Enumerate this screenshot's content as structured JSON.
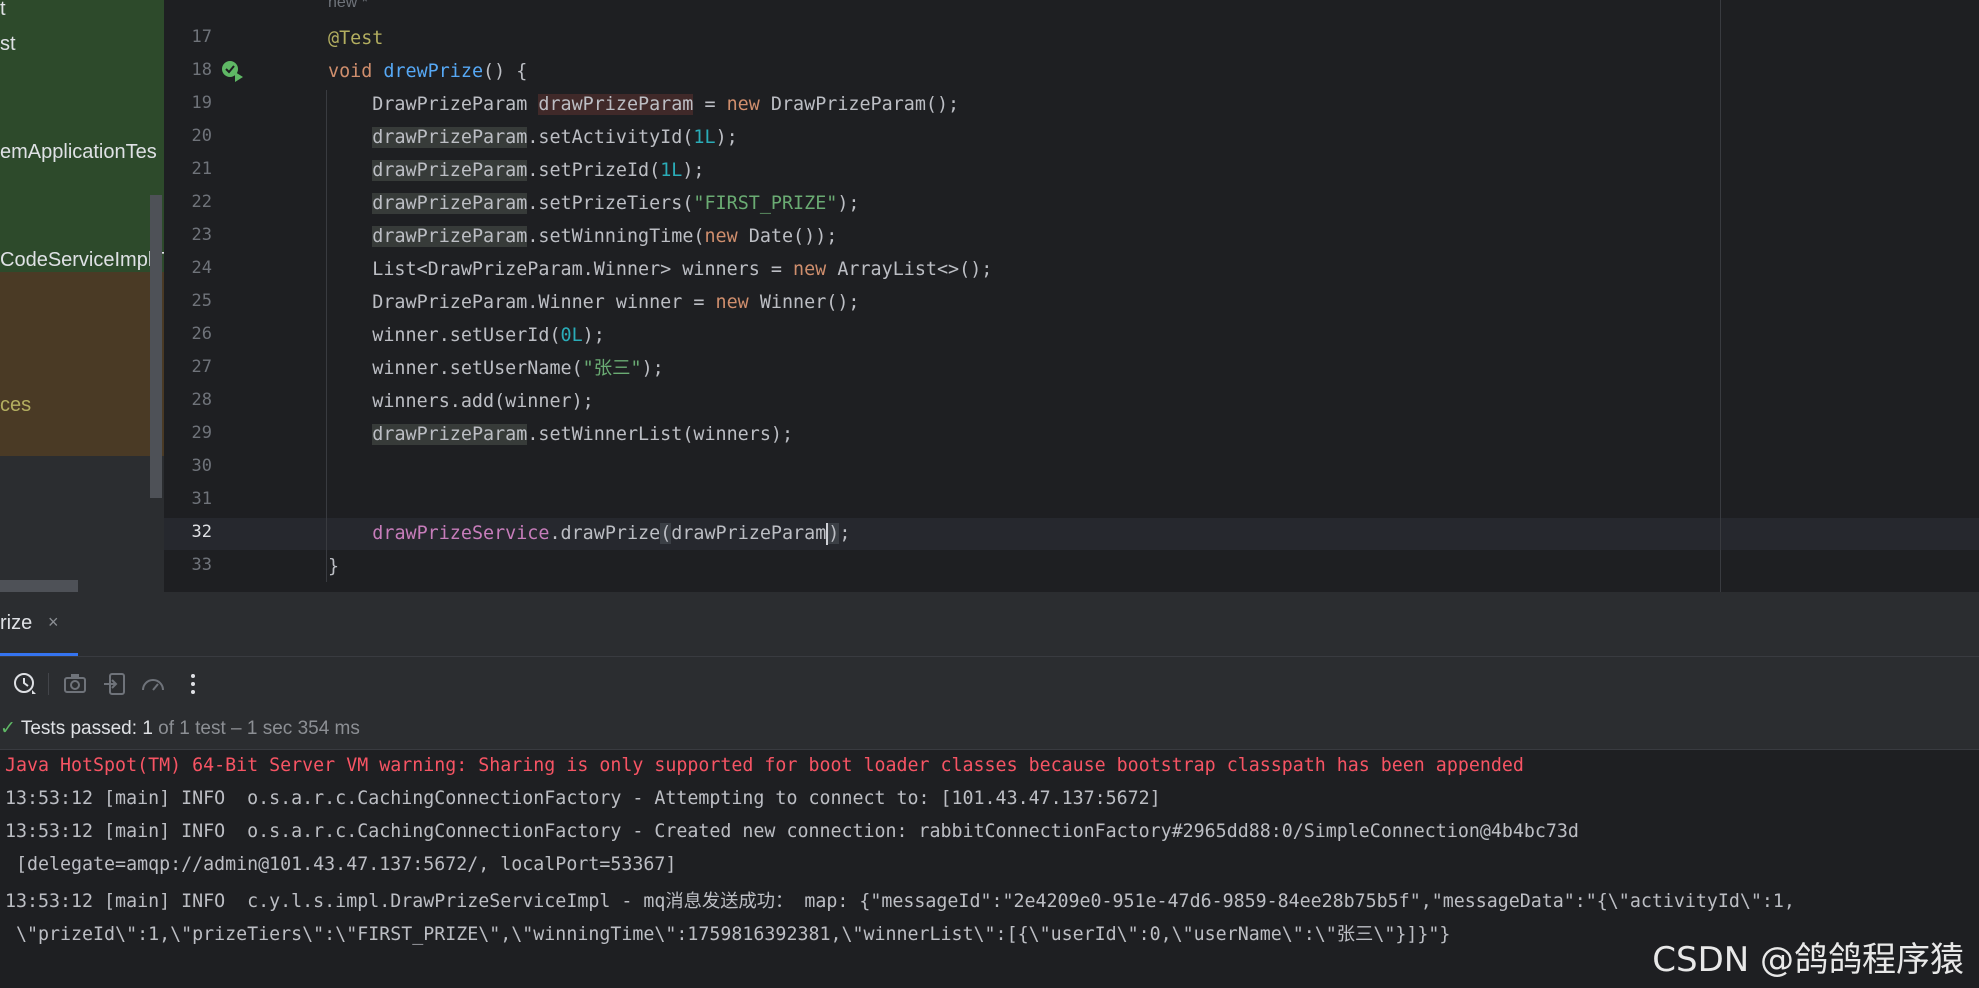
{
  "sidebar": {
    "items": [
      {
        "label": "t"
      },
      {
        "label": "st"
      },
      {
        "label": "emApplicationTes"
      },
      {
        "label": "CodeServiceImplT"
      },
      {
        "label": "ces"
      }
    ]
  },
  "editor": {
    "inlay_hint": "new *",
    "current_line": 32,
    "lines": [
      {
        "no": "17"
      },
      {
        "no": "18"
      },
      {
        "no": "19"
      },
      {
        "no": "20"
      },
      {
        "no": "21"
      },
      {
        "no": "22"
      },
      {
        "no": "23"
      },
      {
        "no": "24"
      },
      {
        "no": "25"
      },
      {
        "no": "26"
      },
      {
        "no": "27"
      },
      {
        "no": "28"
      },
      {
        "no": "29"
      },
      {
        "no": "30"
      },
      {
        "no": "31"
      },
      {
        "no": "32"
      },
      {
        "no": "33"
      }
    ]
  },
  "run_panel": {
    "tab_label": "rize",
    "tab_close": "×",
    "status_check": "✓",
    "status_label": "Tests passed:",
    "status_count": "1",
    "status_detail": "of 1 test – 1 sec 354 ms",
    "console": [
      {
        "text": "Java HotSpot(TM) 64-Bit Server VM warning: Sharing is only supported for boot loader classes because bootstrap classpath has been appended",
        "type": "err"
      },
      {
        "text": "13:53:12 [main] INFO  o.s.a.r.c.CachingConnectionFactory - Attempting to connect to: [101.43.47.137:5672]",
        "type": "info"
      },
      {
        "text": "13:53:12 [main] INFO  o.s.a.r.c.CachingConnectionFactory - Created new connection: rabbitConnectionFactory#2965dd88:0/SimpleConnection@4b4bc73d",
        "type": "info"
      },
      {
        "text": " [delegate=amqp://admin@101.43.47.137:5672/, localPort=53367]",
        "type": "info"
      },
      {
        "text": "13:53:12 [main] INFO  c.y.l.s.impl.DrawPrizeServiceImpl - mq消息发送成功： map: {\"messageId\":\"2e4209e0-951e-47d6-9859-84ee28b75b5f\",\"messageData\":\"{\\\"activityId\\\":1,",
        "type": "info"
      },
      {
        "text": " \\\"prizeId\\\":1,\\\"prizeTiers\\\":\\\"FIRST_PRIZE\\\",\\\"winningTime\\\":1759816392381,\\\"winnerList\\\":[{\\\"userId\\\":0,\\\"userName\\\":\\\"张三\\\"}]}\"}",
        "type": "info"
      }
    ]
  },
  "watermark": "CSDN @鸽鸽程序猿",
  "colors": {
    "keyword": "#cf8e6d",
    "method": "#56a8f5",
    "annotation": "#b3ae60",
    "number": "#2aacb8",
    "string": "#6aab73",
    "field": "#c77dbb",
    "error": "#f75464"
  }
}
